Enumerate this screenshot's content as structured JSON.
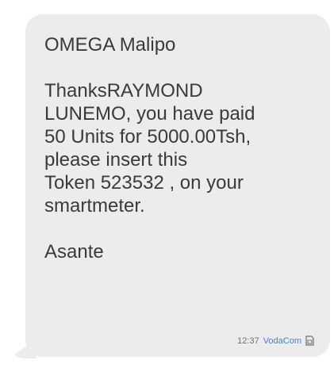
{
  "message": {
    "sender": "OMEGA Malipo",
    "body_lines": [
      "ThanksRAYMOND",
      "LUNEMO, you have paid",
      "50 Units for 5000.00Tsh,",
      "please insert this",
      "Token 523532 , on your",
      "smartmeter."
    ],
    "closing": "Asante"
  },
  "meta": {
    "time": "12:37",
    "carrier": "VodaCom",
    "sim_icon": "sim-card-icon"
  },
  "colors": {
    "bubble": "#ececec",
    "text": "#3a3a3a",
    "time": "#6f6f6f",
    "carrier": "#3d7fe0"
  }
}
